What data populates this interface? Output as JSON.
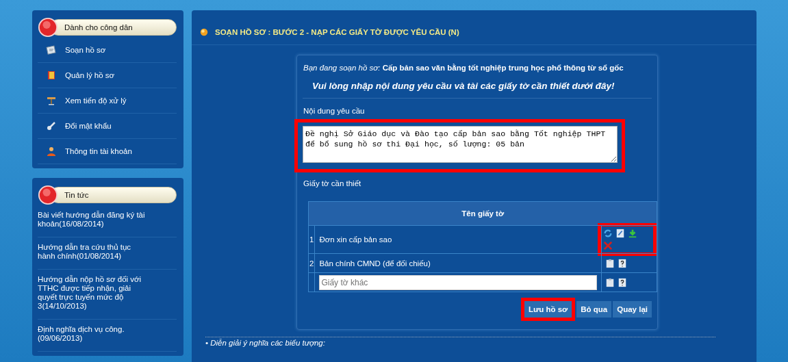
{
  "sidebar": {
    "sections": [
      {
        "title": "Dành cho công dân",
        "kind": "menu",
        "items": [
          {
            "label": "Soạn hồ sơ"
          },
          {
            "label": "Quản lý hồ sơ"
          },
          {
            "label": "Xem tiến độ xử lý"
          },
          {
            "label": "Đổi mật khẩu"
          },
          {
            "label": "Thông tin tài khoản"
          }
        ]
      },
      {
        "title": "Tin tức",
        "kind": "news",
        "items": [
          {
            "label": "Bài viết hướng dẫn đăng ký tài khoản(16/08/2014)"
          },
          {
            "label": "Hướng dẫn tra cứu thủ tục hành chính(01/08/2014)"
          },
          {
            "label": "Hướng dẫn nộp hồ sơ đối với TTHC được tiếp nhận, giải quyết trực tuyến mức độ 3(14/10/2013)"
          },
          {
            "label": "Định nghĩa dịch vụ công.(09/06/2013)"
          }
        ]
      }
    ]
  },
  "main": {
    "heading": "SOẠN HỒ SƠ : BƯỚC 2 - NẠP CÁC GIẤY TỜ ĐƯỢC YÊU CẦU (N)",
    "intro": "*Bạn đang soạn hồ sơ:* **Cấp bản sao văn bằng tốt nghiệp trung học phổ thông từ sổ gốc**",
    "instruction": "Vui lòng nhập nội dung yêu cầu và tài các giấy tờ cần thiết dưới đây!",
    "request_label": "Nội dung yêu cầu",
    "request": {
      "value": "Đề nghị Sở Giáo dục và Đào tạo cấp bản sao bằng Tốt nghiệp THPT để bổ sung hồ sơ thi Đại học, số lượng: 05 bản",
      "highlighted": true
    },
    "documents_label": "Giấy tờ cần thiết",
    "table": {
      "column": "Tên giấy tờ",
      "rows": [
        {
          "kind": "item",
          "number": "1",
          "name": "Đơn xin cấp bản sao",
          "uploaded": true,
          "highlighted": true
        },
        {
          "kind": "item",
          "number": "2",
          "name": "Bản chính CMND (để đối chiếu)",
          "uploaded": false,
          "highlighted": false
        },
        {
          "kind": "input",
          "placeholder": "Giấy tờ khác",
          "uploaded": false,
          "highlighted": false
        }
      ]
    },
    "buttons": [
      {
        "label": "Lưu hồ sơ",
        "highlighted": true
      },
      {
        "label": "Bỏ qua",
        "highlighted": false
      },
      {
        "label": "Quay lại",
        "highlighted": false
      }
    ],
    "footnote": "• Diễn giải ý nghĩa các biểu tượng:"
  }
}
